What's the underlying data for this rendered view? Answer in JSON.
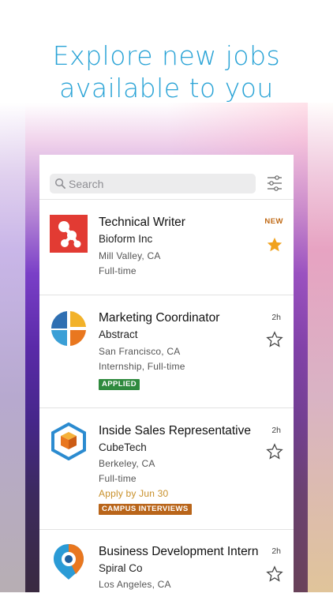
{
  "headline": {
    "line1": "Explore new jobs",
    "line2": "available to you"
  },
  "search": {
    "placeholder": "Search"
  },
  "colors": {
    "accent": "#29a3d6",
    "applied_badge": "#2f8a3e",
    "campus_badge": "#b9651a",
    "star_active": "#f1a21c"
  },
  "jobs": [
    {
      "title": "Technical Writer",
      "company": "Bioform Inc",
      "location": "Mill Valley, CA",
      "type": "Full-time",
      "time": "NEW",
      "starred": true,
      "logo": "bioform-logo"
    },
    {
      "title": "Marketing Coordinator",
      "company": "Abstract",
      "location": "San Francisco, CA",
      "type": "Internship, Full-time",
      "time": "2h",
      "badge": "APPLIED",
      "starred": false,
      "logo": "abstract-logo"
    },
    {
      "title": "Inside Sales Representative",
      "company": "CubeTech",
      "location": "Berkeley, CA",
      "type": "Full-time",
      "apply_by": "Apply by Jun 30",
      "time": "2h",
      "badge": "CAMPUS INTERVIEWS",
      "starred": false,
      "logo": "cubetech-logo"
    },
    {
      "title": "Business Development Intern",
      "company": "Spiral Co",
      "location": "Los Angeles, CA",
      "time": "2h",
      "starred": false,
      "logo": "spiral-logo"
    }
  ]
}
